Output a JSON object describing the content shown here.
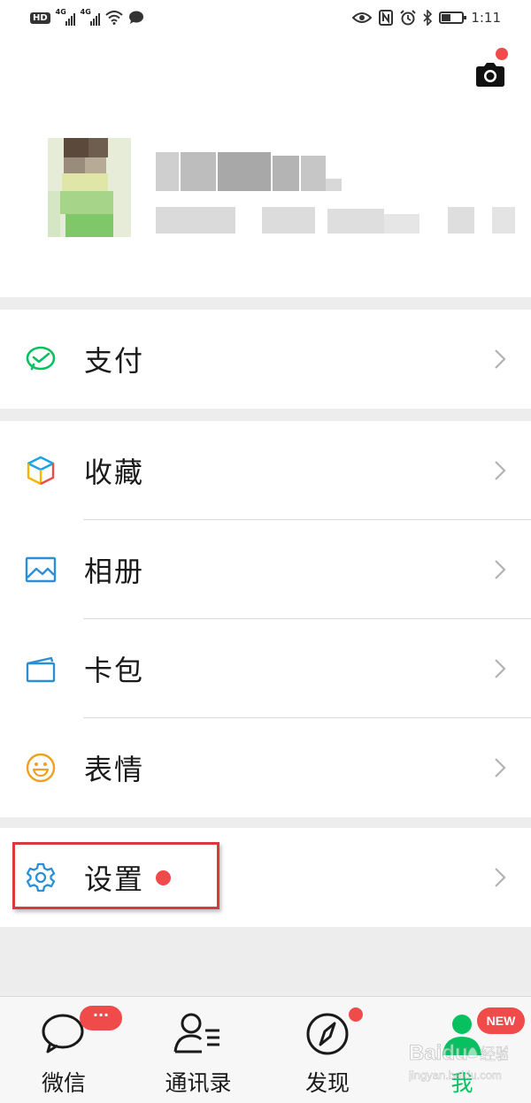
{
  "status_bar": {
    "hd": "HD",
    "net1": "4G",
    "net2": "4G",
    "time": "1:11"
  },
  "colors": {
    "accent_green": "#07c160",
    "badge_red": "#f04b4b",
    "annotation_red": "#d83a3a"
  },
  "profile": {
    "camera_icon": "camera-icon"
  },
  "menu": {
    "pay": {
      "label": "支付",
      "icon": "pay-check-icon"
    },
    "favorites": {
      "label": "收藏",
      "icon": "favorites-cube-icon"
    },
    "album": {
      "label": "相册",
      "icon": "album-image-icon"
    },
    "cards": {
      "label": "卡包",
      "icon": "card-wallet-icon"
    },
    "stickers": {
      "label": "表情",
      "icon": "smiley-icon"
    },
    "settings": {
      "label": "设置",
      "icon": "gear-icon"
    }
  },
  "tabbar": {
    "chats": {
      "label": "微信",
      "badge": "···"
    },
    "contacts": {
      "label": "通讯录"
    },
    "discover": {
      "label": "发现"
    },
    "me": {
      "label": "我",
      "badge": "NEW"
    }
  },
  "watermark": {
    "brand": "Baidu",
    "text": "经验",
    "url": "jingyan.baidu.com"
  }
}
